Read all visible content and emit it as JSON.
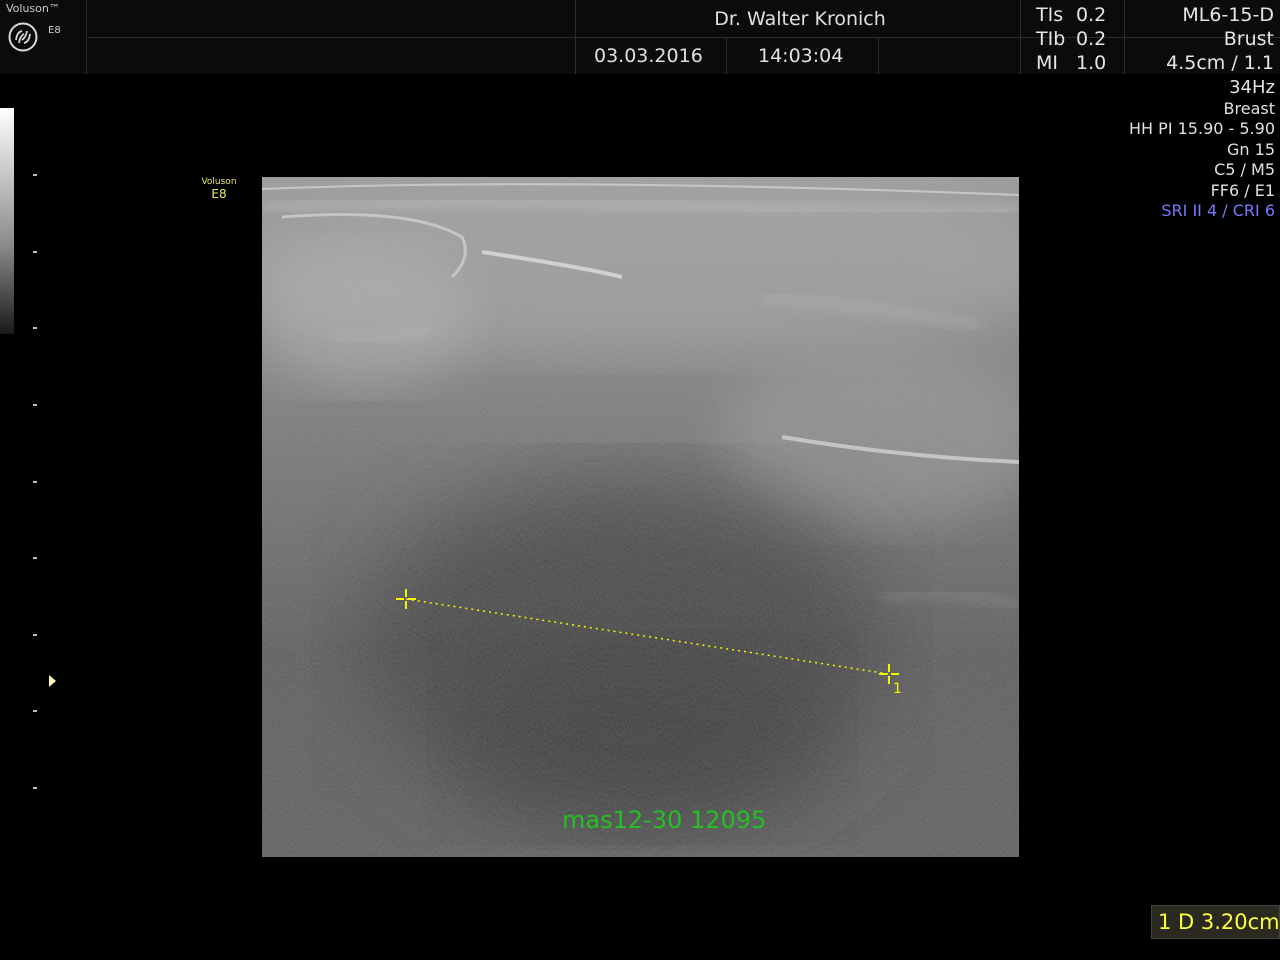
{
  "header": {
    "brand": "Voluson™",
    "model_small": "E8",
    "doctor": "Dr. Walter Kronich",
    "date": "03.03.2016",
    "time": "14:03:04",
    "tis_label": "TIs",
    "tis_value": "0.2",
    "tib_label": "TIb",
    "tib_value": "0.2",
    "mi_label": "MI",
    "mi_value": "1.0",
    "probe": "ML6-15-D",
    "application": "Brust",
    "depth_zoom": "4.5cm / 1.1"
  },
  "params": {
    "frame_rate": "34Hz",
    "preset": "Breast",
    "harmonic": "HH PI 15.90 - 5.90",
    "gain": "Gn  15",
    "c_m": "C5 / M5",
    "ff_e": "FF6 / E1",
    "sri_cri": "SRI II 4 / CRI 6"
  },
  "watermark": {
    "brand": "Voluson",
    "model": "E8"
  },
  "annotation": {
    "text": "mas12-30 12095"
  },
  "measurement": {
    "caliper_label": "1",
    "result": "1 D 3.20cm"
  },
  "colors": {
    "annotation": "#22c022",
    "caliper": "#f5f500",
    "sri_text": "#7878ff",
    "watermark": "#e8e86a"
  }
}
